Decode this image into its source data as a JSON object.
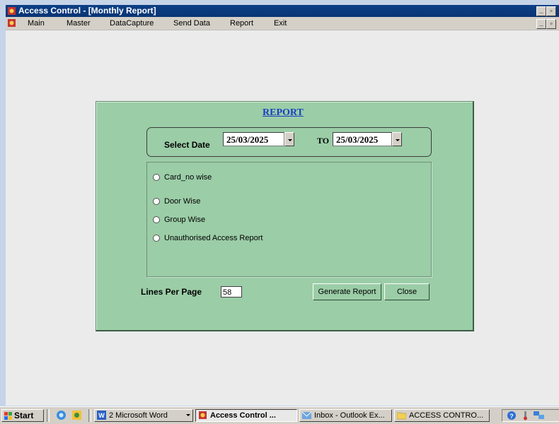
{
  "window": {
    "title": "Access Control - [Monthly Report]"
  },
  "menu": {
    "items": [
      "Main",
      "Master",
      "DataCapture",
      "Send Data",
      "Report",
      "Exit"
    ]
  },
  "report": {
    "title": "REPORT",
    "select_date_label": "Select Date",
    "from_date": "25/03/2025",
    "to_label": "TO",
    "to_date": "25/03/2025",
    "options": [
      "Card_no wise",
      "Door Wise",
      "Group Wise",
      "Unauthorised Access Report"
    ],
    "lines_per_page_label": "Lines Per Page",
    "lines_per_page_value": "58",
    "generate_button": "Generate Report",
    "close_button": "Close"
  },
  "taskbar": {
    "start": "Start",
    "tasks": [
      "2 Microsoft Word",
      "Access Control ...",
      "Inbox - Outlook Ex...",
      "ACCESS CONTRO..."
    ]
  },
  "colors": {
    "panel": "#9bcda7",
    "titlebar": "#0b3f86",
    "report_title": "#1a3fc2"
  }
}
